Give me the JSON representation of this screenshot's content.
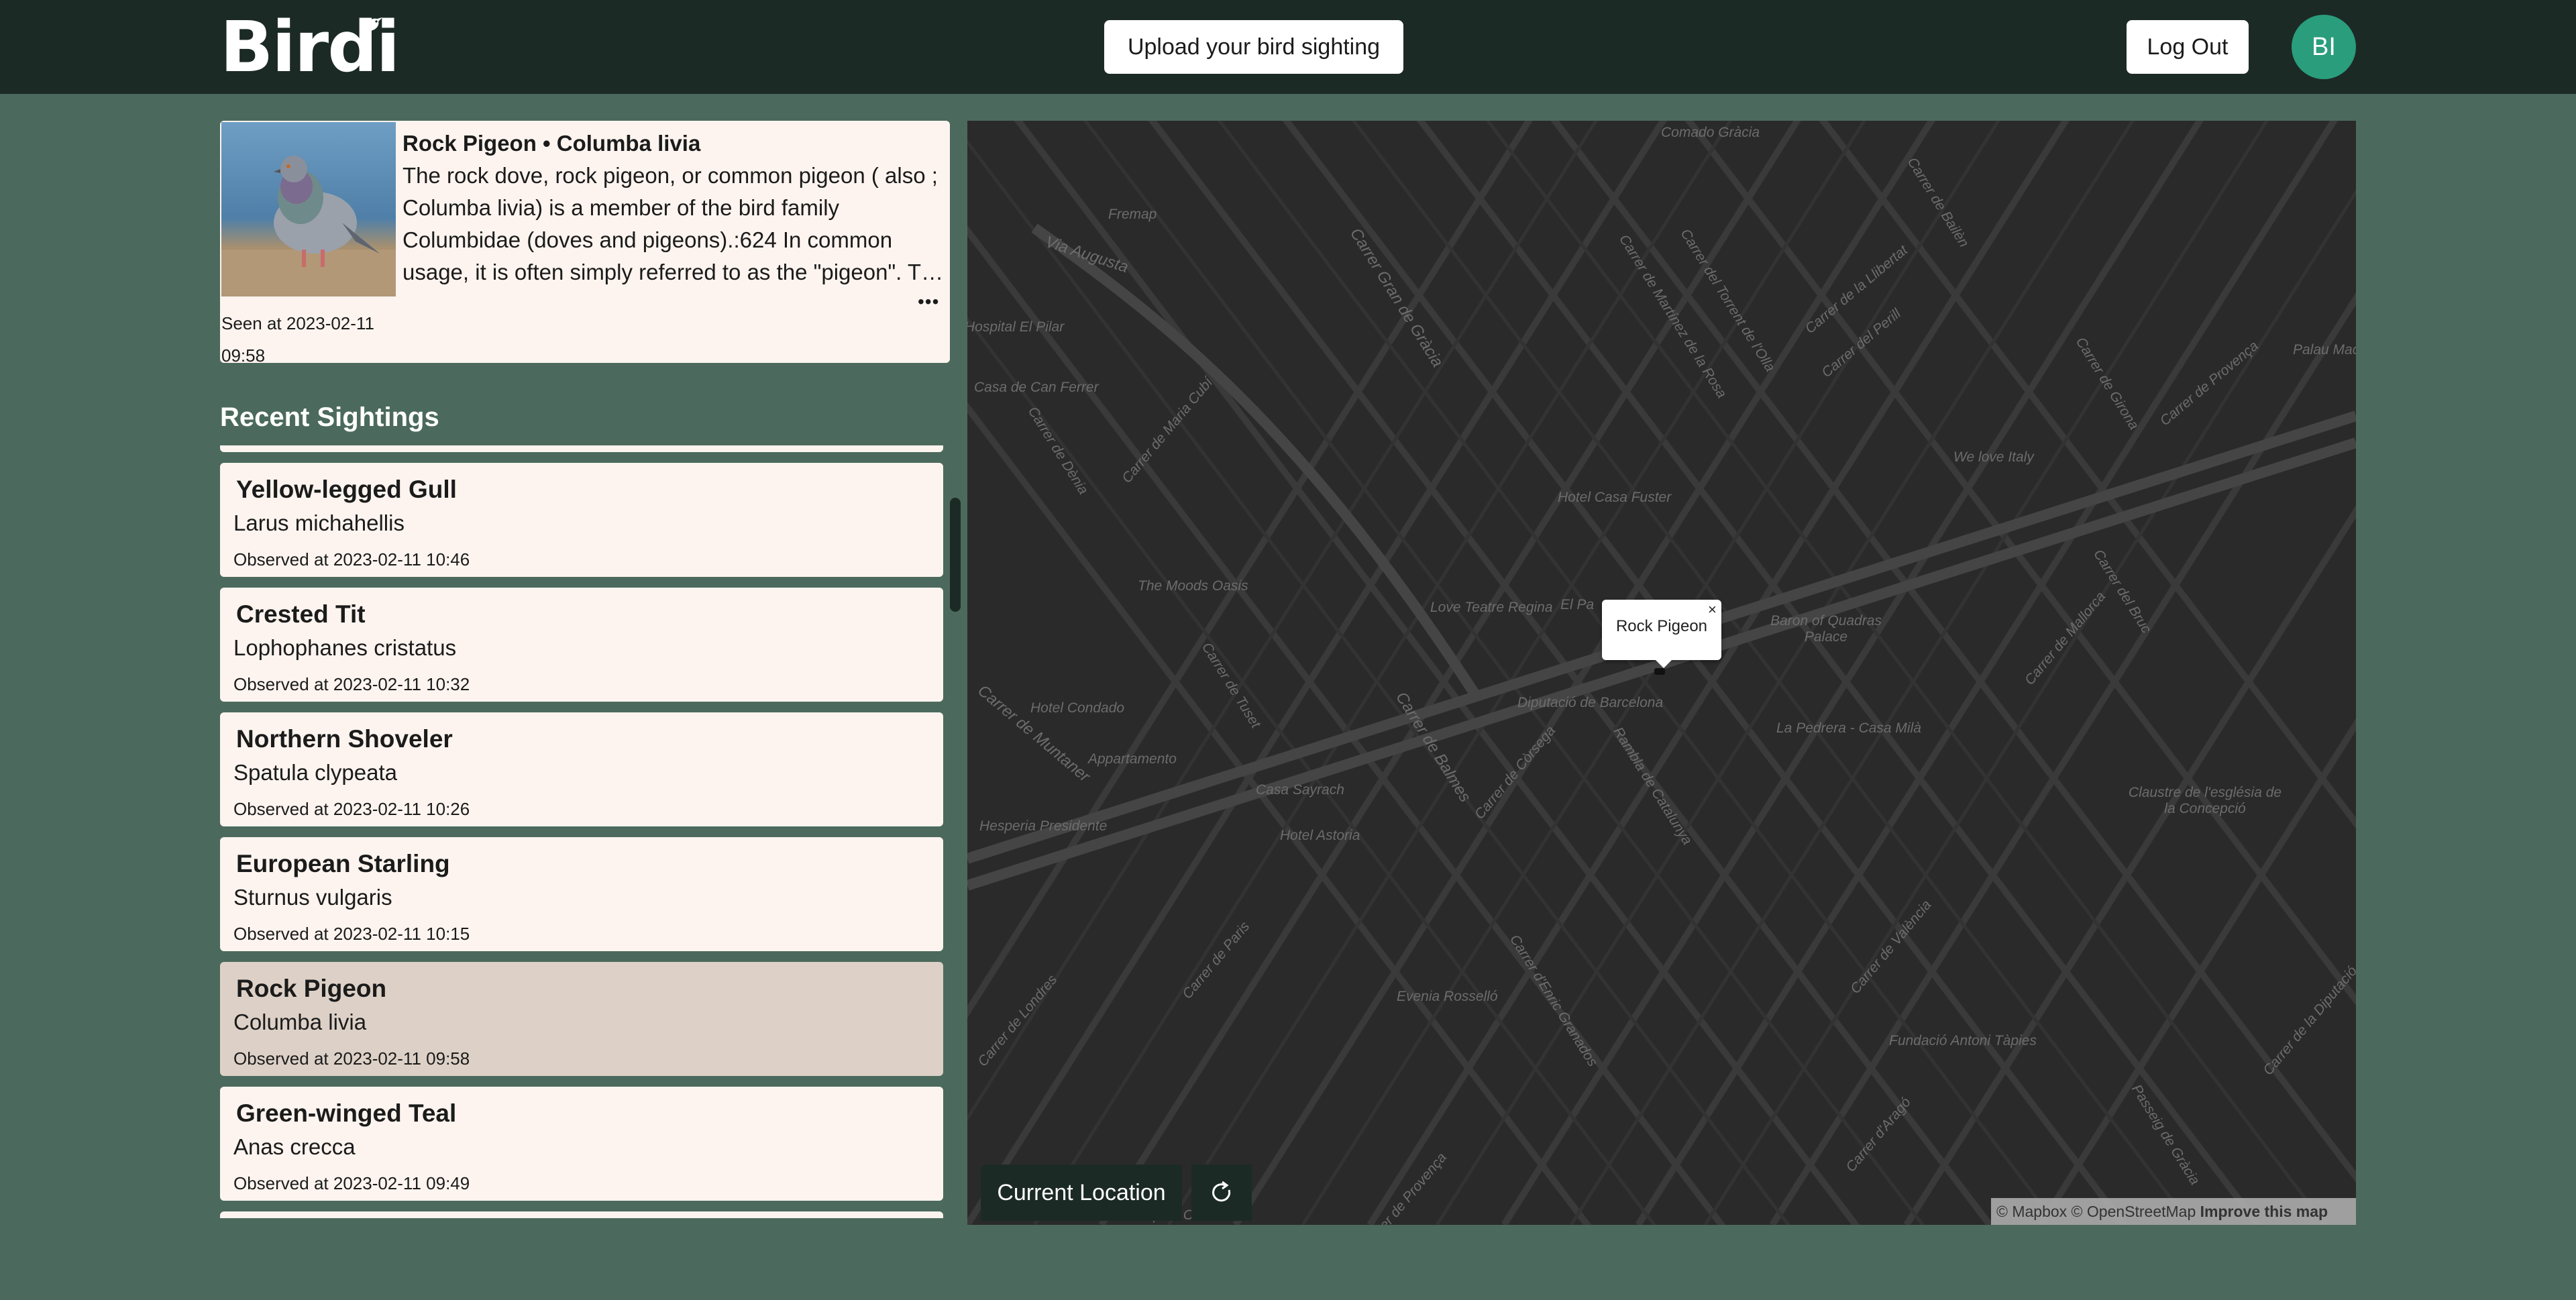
{
  "header": {
    "logo": "Birdi",
    "upload_label": "Upload your bird sighting",
    "logout_label": "Log Out",
    "avatar_initials": "BI"
  },
  "featured": {
    "title": "Rock Pigeon • Columba livia",
    "description": "The rock dove, rock pigeon, or common pigeon ( also ; Columba livia) is a member of the bird family Columbidae (doves and pigeons).:624 In common usage, it is often simply referred to as the \"pigeon\". The domestic pigeon is descended from the rock dove.",
    "seen_at": "Seen at 2023-02-11 09:58",
    "image_icon": "rock-pigeon-photo"
  },
  "recent": {
    "title": "Recent Sightings",
    "items": [
      {
        "common": "Yellow-legged Gull",
        "scientific": "Larus michahellis",
        "observed": "Observed at 2023-02-11 10:46",
        "selected": false
      },
      {
        "common": "Crested Tit",
        "scientific": "Lophophanes cristatus",
        "observed": "Observed at 2023-02-11 10:32",
        "selected": false
      },
      {
        "common": "Northern Shoveler",
        "scientific": "Spatula clypeata",
        "observed": "Observed at 2023-02-11 10:26",
        "selected": false
      },
      {
        "common": "European Starling",
        "scientific": "Sturnus vulgaris",
        "observed": "Observed at 2023-02-11 10:15",
        "selected": false
      },
      {
        "common": "Rock Pigeon",
        "scientific": "Columba livia",
        "observed": "Observed at 2023-02-11 09:58",
        "selected": true
      },
      {
        "common": "Green-winged Teal",
        "scientific": "Anas crecca",
        "observed": "Observed at 2023-02-11 09:49",
        "selected": false
      }
    ]
  },
  "map": {
    "popup_label": "Rock Pigeon",
    "current_location_label": "Current Location",
    "attribution_prefix": "© Mapbox © OpenStreetMap",
    "improve_label": "Improve this map",
    "labels": [
      "Comado Gràcia",
      "Fremap",
      "Via Augusta",
      "Carrer Gran de Gràcia",
      "Carrer de Martínez de la Rosa",
      "Carrer del Torrent de l'Olla",
      "Carrer de la Llibertat",
      "Carrer del Perill",
      "Carrer de Bailèn",
      "Carrer de Girona",
      "Carrer de Provença",
      "We love Italy",
      "Hotel Casa Fuster",
      "The Moods Oasis",
      "Love Teatre Regina",
      "El Pa",
      "Baron of Quadras Palace",
      "Carrer de Tuset",
      "Hotel Condado",
      "Diputació de Barcelona",
      "La Pedrera - Casa Milà",
      "Carrer de Balmes",
      "Carrer de Còrsega",
      "Rambla de Catalunya",
      "Carrer de Mallorca",
      "Carrer del Bruc",
      "Appartamento",
      "Casa Sayrach",
      "Hotel Astoria",
      "Hesperia Presidente",
      "Carrer de Muntaner",
      "Carrer de Paris",
      "Evenia Rosselló",
      "Carrer d'Enric Granados",
      "Carrer de València",
      "Fundació Antoni Tàpies",
      "Claustre de l'església de la Concepció",
      "Carrer de Londres",
      "Carrer de Provença",
      "Carrer d'Aragó",
      "Passeig de Gràcia",
      "Carrer de la Diputació",
      "Carrer de Maria Cubí",
      "Carrer de Dènia",
      "Casa de Can Ferrer",
      "Hospital El Pilar",
      "Palau Macaya",
      "Carrer de Muntaner",
      "Hospital Clínic",
      "Carrer de Còrsega",
      "Carrer de Balmes"
    ]
  }
}
